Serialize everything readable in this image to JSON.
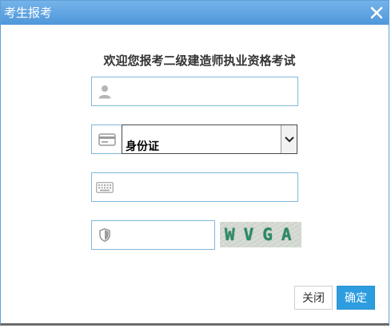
{
  "dialog": {
    "title": "考生报考",
    "heading": "欢迎您报考二级建造师执业资格考试"
  },
  "form": {
    "username": {
      "value": "",
      "placeholder": "",
      "icon": "user-icon"
    },
    "id_type": {
      "selected": "身份证",
      "icon": "id-card-icon"
    },
    "id_number": {
      "value": "",
      "placeholder": "",
      "icon": "keyboard-icon"
    },
    "captcha": {
      "value": "",
      "placeholder": "",
      "icon": "shield-icon",
      "image_text": "WVGA"
    }
  },
  "buttons": {
    "close_label": "关闭",
    "confirm_label": "确定"
  },
  "colors": {
    "title_bar": "#4f97da",
    "field_border": "#7fb8d9",
    "confirm_button": "#2e9de0"
  }
}
